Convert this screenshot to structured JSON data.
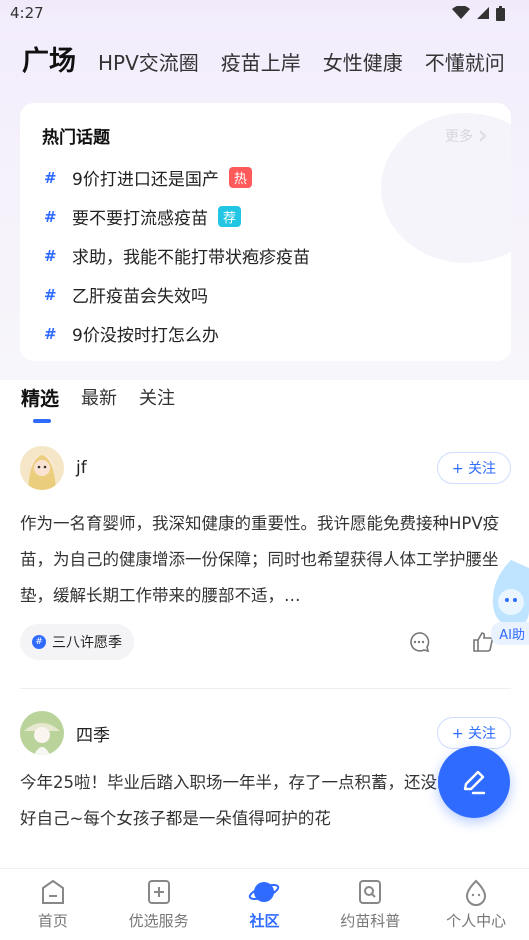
{
  "status": {
    "time": "4:27"
  },
  "tabs": [
    "广场",
    "HPV交流圈",
    "疫苗上岸",
    "女性健康",
    "不懂就问"
  ],
  "hot": {
    "title": "热门话题",
    "more": "更多",
    "topics": [
      {
        "hash": "#",
        "text": "9价打进口还是国产",
        "tag": "热"
      },
      {
        "hash": "#",
        "text": "要不要打流感疫苗",
        "tag": "荐"
      },
      {
        "hash": "#",
        "text": "求助，我能不能打带状疱疹疫苗",
        "tag": ""
      },
      {
        "hash": "#",
        "text": "乙肝疫苗会失效吗",
        "tag": ""
      },
      {
        "hash": "#",
        "text": "9价没按时打怎么办",
        "tag": ""
      }
    ]
  },
  "feed_tabs": [
    "精选",
    "最新",
    "关注"
  ],
  "posts": [
    {
      "author": "jf",
      "follow": "+ 关注",
      "text": "作为一名育婴师，我深知健康的重要性。我许愿能免费接种HPV疫苗，为自己的健康增添一份保障；同时也希望获得人体工学护腰坐垫，缓解长期工作带来的腰部不适，…",
      "chip": "三八许愿季"
    },
    {
      "author": "四季",
      "follow": "+ 关注",
      "text": "今年25啦！毕业后踏入职场一年半，存了一点积蓄，还没26保护好自己~每个女孩子都是一朵值得呵护的花"
    }
  ],
  "ai_label": "AI助",
  "nav": [
    "首页",
    "优选服务",
    "社区",
    "约苗科普",
    "个人中心"
  ],
  "colors": {
    "accent": "#2f6bff",
    "hot_tag": "#ff5a5a",
    "rec_tag": "#22c6e3"
  }
}
